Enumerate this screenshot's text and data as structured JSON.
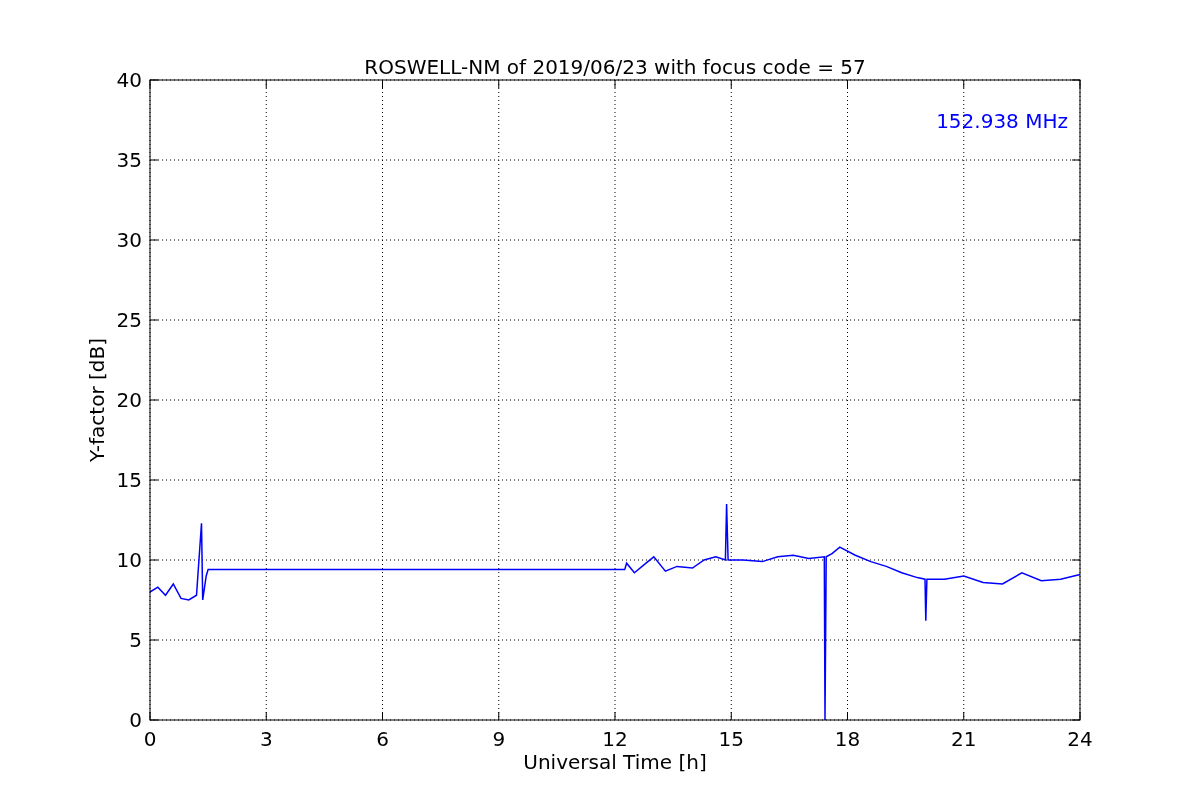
{
  "chart_data": {
    "type": "line",
    "title": "ROSWELL-NM of 2019/06/23 with focus code = 57",
    "xlabel": "Universal Time [h]",
    "ylabel": "Y-factor [dB]",
    "x": [
      0,
      0.2,
      0.4,
      0.6,
      0.8,
      1.0,
      1.2,
      1.33,
      1.36,
      1.45,
      1.5,
      12.25,
      12.3,
      12.5,
      12.8,
      13.0,
      13.3,
      13.6,
      14.0,
      14.3,
      14.6,
      14.85,
      14.88,
      14.92,
      15.3,
      15.8,
      16.2,
      16.6,
      17.0,
      17.4,
      17.42,
      17.45,
      17.6,
      17.8,
      18.2,
      18.6,
      19.0,
      19.4,
      19.8,
      20.0,
      20.02,
      20.05,
      20.5,
      21.0,
      21.5,
      22.0,
      22.5,
      23.0,
      23.5,
      24.0
    ],
    "series": [
      {
        "name": "152.938 MHz",
        "color": "#0000ff",
        "values": [
          8.0,
          8.3,
          7.8,
          8.5,
          7.6,
          7.5,
          7.8,
          12.3,
          7.5,
          9.0,
          9.4,
          9.4,
          9.8,
          9.2,
          9.8,
          10.2,
          9.3,
          9.6,
          9.5,
          10.0,
          10.2,
          10.0,
          13.5,
          10.0,
          10.0,
          9.9,
          10.2,
          10.3,
          10.1,
          10.2,
          0,
          10.2,
          10.4,
          10.8,
          10.3,
          9.9,
          9.6,
          9.2,
          8.9,
          8.8,
          6.2,
          8.8,
          8.8,
          9.0,
          8.6,
          8.5,
          9.2,
          8.7,
          8.8,
          9.1
        ]
      }
    ],
    "xlim": [
      0,
      24
    ],
    "ylim": [
      0,
      40
    ],
    "xticks": [
      0,
      3,
      6,
      9,
      12,
      15,
      18,
      21,
      24
    ],
    "yticks": [
      0,
      5,
      10,
      15,
      20,
      25,
      30,
      35,
      40
    ],
    "grid": true
  }
}
